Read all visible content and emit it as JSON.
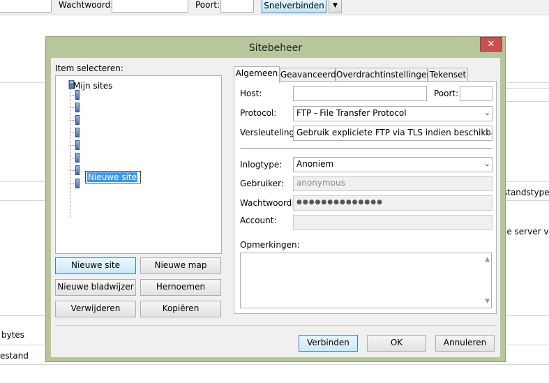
{
  "background": {
    "password_label": "Wachtwoord:",
    "port_label": "Poort:",
    "quickconnect_label": "Snelverbinden",
    "dropdown_arrow": "▼",
    "conn_type_text": "standstype",
    "server_text": "le server ver",
    "bytes_text": "bytes",
    "file_text": "estand"
  },
  "dialog": {
    "title": "Sitebeheer",
    "close_icon": "✕",
    "select_item_label": "Item selecteren:",
    "tree": {
      "root_label": "Mijn sites",
      "edit_value": "Nieuwe site"
    },
    "buttons": {
      "new_site": "Nieuwe site",
      "new_folder": "Nieuwe map",
      "new_bookmark": "Nieuwe bladwijzer",
      "rename": "Hernoemen",
      "delete": "Verwijderen",
      "copy": "Kopiëren"
    },
    "tabs": [
      "Algemeen",
      "Geavanceerd",
      "Overdrachtinstellingen",
      "Tekenset"
    ],
    "general": {
      "host_label": "Host:",
      "host_value": "",
      "port_label": "Poort:",
      "port_value": "",
      "protocol_label": "Protocol:",
      "protocol_value": "FTP - File Transfer Protocol",
      "encryption_label": "Versleuteling:",
      "encryption_value": "Gebruik expliciete FTP via TLS indien beschikbaar",
      "logontype_label": "Inlogtype:",
      "logontype_value": "Anoniem",
      "user_label": "Gebruiker:",
      "user_value": "anonymous",
      "password_label": "Wachtwoord:",
      "password_value": "●●●●●●●●●●●●●●",
      "account_label": "Account:",
      "account_value": "",
      "comments_label": "Opmerkingen:"
    },
    "footer": {
      "connect": "Verbinden",
      "ok": "OK",
      "cancel": "Annuleren"
    }
  }
}
